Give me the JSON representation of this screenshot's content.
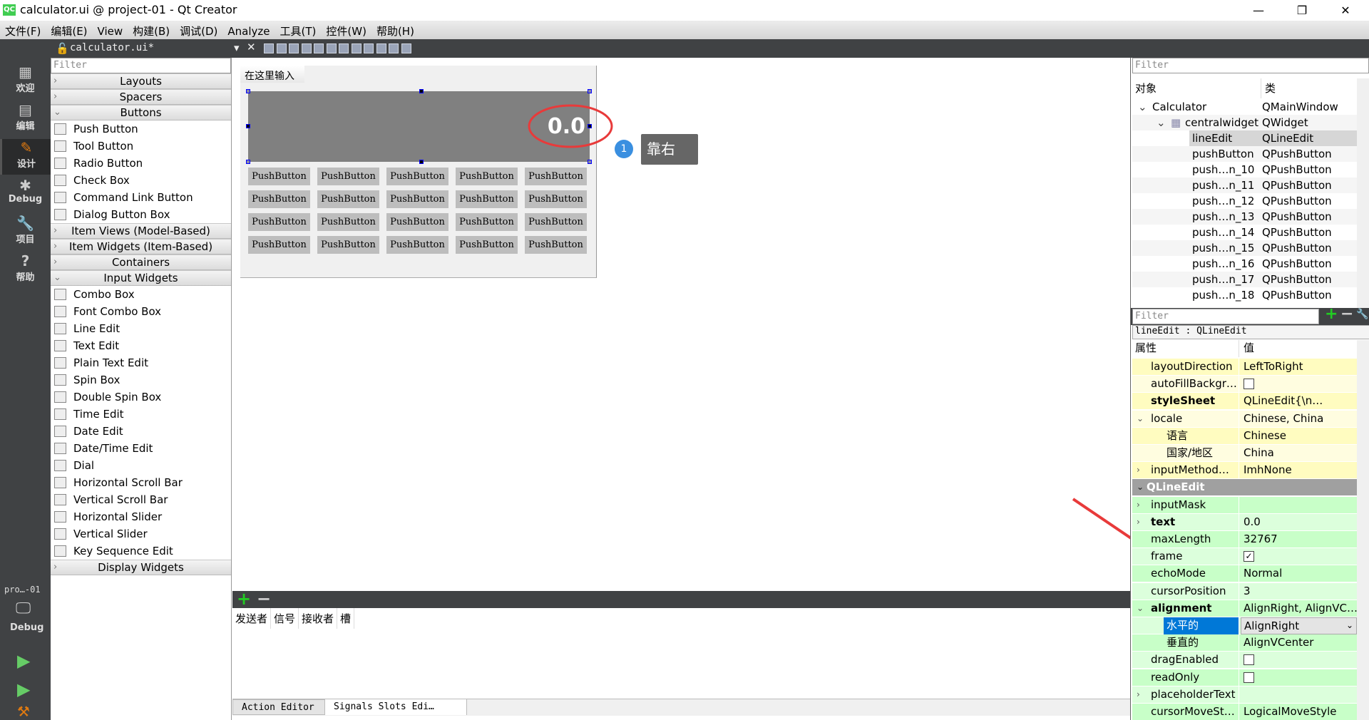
{
  "window": {
    "title": "calculator.ui @ project-01 - Qt Creator",
    "logo": "QC"
  },
  "menu": [
    "文件(F)",
    "编辑(E)",
    "View",
    "构建(B)",
    "调试(D)",
    "Analyze",
    "工具(T)",
    "控件(W)",
    "帮助(H)"
  ],
  "toolbar": {
    "file": "calculator.ui*"
  },
  "modes": [
    {
      "label": "欢迎",
      "icon": "grid-icon"
    },
    {
      "label": "编辑",
      "icon": "document-icon"
    },
    {
      "label": "设计",
      "icon": "pencil-icon",
      "selected": true
    },
    {
      "label": "Debug",
      "icon": "bug-icon"
    },
    {
      "label": "项目",
      "icon": "wrench-icon"
    },
    {
      "label": "帮助",
      "icon": "help-icon"
    }
  ],
  "kit": {
    "project": "pro…-01",
    "mode": "Debug"
  },
  "widgetbox": {
    "filter_placeholder": "Filter",
    "sections": [
      {
        "label": "Layouts",
        "expanded": false
      },
      {
        "label": "Spacers",
        "expanded": false
      },
      {
        "label": "Buttons",
        "expanded": true,
        "items": [
          "Push Button",
          "Tool Button",
          "Radio Button",
          "Check Box",
          "Command Link Button",
          "Dialog Button Box"
        ]
      },
      {
        "label": "Item Views (Model-Based)",
        "expanded": false
      },
      {
        "label": "Item Widgets (Item-Based)",
        "expanded": false
      },
      {
        "label": "Containers",
        "expanded": false
      },
      {
        "label": "Input Widgets",
        "expanded": true,
        "items": [
          "Combo Box",
          "Font Combo Box",
          "Line Edit",
          "Text Edit",
          "Plain Text Edit",
          "Spin Box",
          "Double Spin Box",
          "Time Edit",
          "Date Edit",
          "Date/Time Edit",
          "Dial",
          "Horizontal Scroll Bar",
          "Vertical Scroll Bar",
          "Horizontal Slider",
          "Vertical Slider",
          "Key Sequence Edit"
        ]
      },
      {
        "label": "Display Widgets",
        "expanded": false
      }
    ]
  },
  "form": {
    "title": "在这里输入",
    "lineedit_text": "0.0",
    "button_label": "PushButton",
    "rows": 4,
    "cols": 5
  },
  "annotation": {
    "badge": "1",
    "tooltip": "靠右",
    "color": "#e83a3a"
  },
  "signals": {
    "headers": [
      "发送者",
      "信号",
      "接收者",
      "槽"
    ],
    "tabs": [
      "Action Editor",
      "Signals  Slots Edi…"
    ]
  },
  "objects": {
    "filter_placeholder": "Filter",
    "headers": [
      "对象",
      "类"
    ],
    "rows": [
      {
        "name": "Calculator",
        "class": "QMainWindow",
        "level": 0
      },
      {
        "name": "centralwidget",
        "class": "QWidget",
        "level": 1
      },
      {
        "name": "lineEdit",
        "class": "QLineEdit",
        "level": 2,
        "selected": true
      },
      {
        "name": "pushButton",
        "class": "QPushButton",
        "level": 2
      },
      {
        "name": "push…n_10",
        "class": "QPushButton",
        "level": 2
      },
      {
        "name": "push…n_11",
        "class": "QPushButton",
        "level": 2
      },
      {
        "name": "push…n_12",
        "class": "QPushButton",
        "level": 2
      },
      {
        "name": "push…n_13",
        "class": "QPushButton",
        "level": 2
      },
      {
        "name": "push…n_14",
        "class": "QPushButton",
        "level": 2
      },
      {
        "name": "push…n_15",
        "class": "QPushButton",
        "level": 2
      },
      {
        "name": "push…n_16",
        "class": "QPushButton",
        "level": 2
      },
      {
        "name": "push…n_17",
        "class": "QPushButton",
        "level": 2
      },
      {
        "name": "push…n_18",
        "class": "QPushButton",
        "level": 2
      }
    ]
  },
  "properties": {
    "filter_placeholder": "Filter",
    "object_label": "lineEdit : QLineEdit",
    "headers": [
      "属性",
      "值"
    ],
    "rows": [
      {
        "name": "layoutDirection",
        "value": "LeftToRight",
        "section": "widget"
      },
      {
        "name": "autoFillBackgr…",
        "checkbox": false,
        "section": "widget"
      },
      {
        "name": "styleSheet",
        "value": "QLineEdit{\\n…",
        "bold": true,
        "section": "widget"
      },
      {
        "name": "locale",
        "value": "Chinese, China",
        "expander": "open",
        "section": "widget"
      },
      {
        "name": "语言",
        "value": "Chinese",
        "indent": true,
        "section": "widget"
      },
      {
        "name": "国家/地区",
        "value": "China",
        "indent": true,
        "section": "widget"
      },
      {
        "name": "inputMethod…",
        "value": "ImhNone",
        "expander": "closed",
        "section": "widget"
      },
      {
        "name": "QLineEdit",
        "header": true
      },
      {
        "name": "inputMask",
        "value": "",
        "expander": "closed",
        "section": "lineedit"
      },
      {
        "name": "text",
        "value": "0.0",
        "bold": true,
        "expander": "closed",
        "section": "lineedit"
      },
      {
        "name": "maxLength",
        "value": "32767",
        "section": "lineedit"
      },
      {
        "name": "frame",
        "checkbox": true,
        "section": "lineedit"
      },
      {
        "name": "echoMode",
        "value": "Normal",
        "section": "lineedit"
      },
      {
        "name": "cursorPosition",
        "value": "3",
        "section": "lineedit"
      },
      {
        "name": "alignment",
        "value": "AlignRight, AlignVC…",
        "bold": true,
        "expander": "open",
        "section": "lineedit"
      },
      {
        "name": "水平的",
        "value": "AlignRight",
        "indent": true,
        "selected": true,
        "dropdown": true,
        "section": "lineedit"
      },
      {
        "name": "垂直的",
        "value": "AlignVCenter",
        "indent": true,
        "section": "lineedit"
      },
      {
        "name": "dragEnabled",
        "checkbox": false,
        "section": "lineedit"
      },
      {
        "name": "readOnly",
        "checkbox": false,
        "section": "lineedit"
      },
      {
        "name": "placeholderText",
        "value": "",
        "expander": "closed",
        "section": "lineedit"
      },
      {
        "name": "cursorMoveSt…",
        "value": "LogicalMoveStyle",
        "section": "lineedit"
      }
    ]
  },
  "colors": {
    "dark": "#404244",
    "widget_section": "#fffcc0",
    "lineedit_section": "#c8ffc8",
    "selection": "#0078d7"
  }
}
